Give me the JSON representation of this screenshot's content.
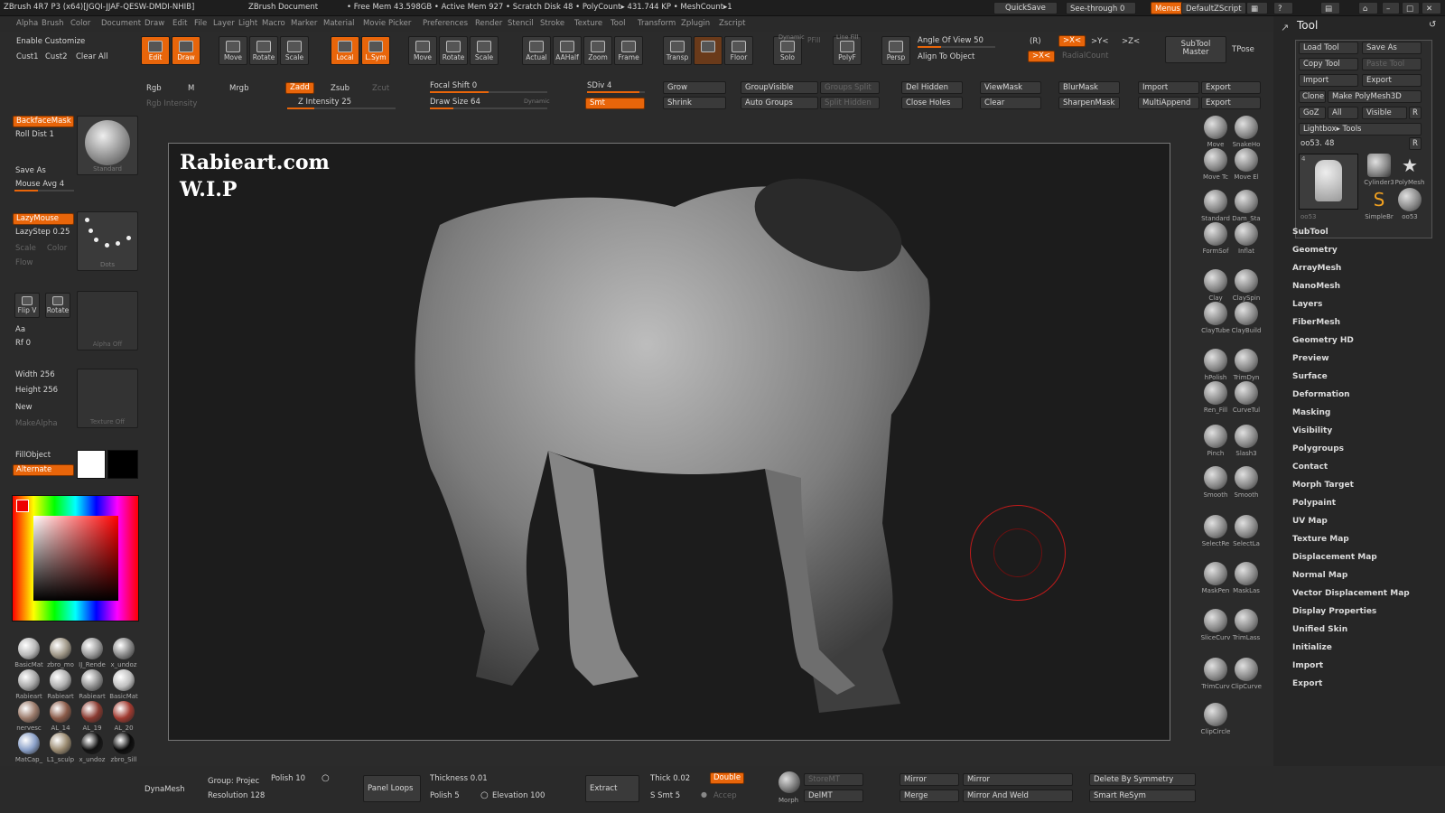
{
  "topbar": {
    "title": "ZBrush 4R7 P3 (x64)[JGQI-JJAF-QESW-DMDI-NHIB]",
    "doc": "ZBrush Document",
    "mem": "• Free Mem 43.598GB • Active Mem 927 • Scratch Disk 48 • PolyCount▸ 431.744 KP • MeshCount▸1",
    "quicksave": "QuickSave",
    "seethrough": "See-through  0",
    "menus": "Menus",
    "script": "DefaultZScript"
  },
  "menu": [
    "Alpha",
    "Brush",
    "Color",
    "Document",
    "Draw",
    "Edit",
    "File",
    "Layer",
    "Light",
    "Macro",
    "Marker",
    "Material",
    "Movie",
    "Picker",
    "Preferences",
    "Render",
    "Stencil",
    "Stroke",
    "Texture",
    "Tool",
    "Transform",
    "Zplugin",
    "Zscript"
  ],
  "toolbar": {
    "enable_customize": "Enable Customize",
    "cust1": "Cust1",
    "cust2": "Cust2",
    "clear_all": "Clear All",
    "tools": [
      "Edit",
      "Draw",
      "Move",
      "Rotate",
      "Scale",
      "Local",
      "L.Sym",
      "Move",
      "Rotate",
      "Scale",
      "Actual",
      "AAHalf",
      "Zoom",
      "Frame",
      "Transp",
      "Ghost",
      "Floor",
      "Solo",
      "PolyF",
      "Persp"
    ],
    "rgb": "Rgb",
    "m": "M",
    "mrgb": "Mrgb",
    "rgb_intensity": "Rgb Intensity",
    "zadd": "Zadd",
    "zsub": "Zsub",
    "zcut": "Zcut",
    "z_intensity": "Z Intensity 25",
    "focal_shift": "Focal Shift 0",
    "draw_size": "Draw Size 64",
    "dynamic": "Dynamic",
    "sdiv": "SDiv 4",
    "smt": "Smt",
    "grow": "Grow",
    "shrink": "Shrink",
    "groupvisible": "GroupVisible",
    "auto_groups": "Auto Groups",
    "groups_split": "Groups Split",
    "split_hidden": "Split Hidden",
    "del_hidden": "Del Hidden",
    "close_holes": "Close Holes",
    "viewmask": "ViewMask",
    "clear": "Clear",
    "blurmask": "BlurMask",
    "sharpenmask": "SharpenMask",
    "import": "Import",
    "multiappend": "MultiAppend",
    "export1": "Export",
    "export2": "Export",
    "angle_of_view": "Angle Of View 50",
    "align_to_object": "Align To Object",
    "r": "(R)",
    "x_sym": ">X<",
    "y_sym": ">Y<",
    "z_sym": ">Z<",
    "radialcount": "RadialCount",
    "subtool_master": "SubTool Master",
    "tpose": "TPose",
    "dynamic_solo": "Dynamic",
    "pfill": "PFill",
    "line_fill": "Line Fill"
  },
  "leftshelf": {
    "backfacemask": "BackfaceMask",
    "roll_dist": "Roll Dist 1",
    "standard": "Standard",
    "save_as": "Save As",
    "mouse_avg": "Mouse Avg 4",
    "lazymouse": "LazyMouse",
    "lazystep": "LazyStep 0.25",
    "scale": "Scale",
    "color": "Color",
    "flow": "Flow",
    "dots": "Dots",
    "flipv": "Flip V",
    "rotate": "Rotate",
    "aa": "Aa",
    "rf": "Rf 0",
    "alpha_off": "Alpha  Off",
    "width": "Width 256",
    "height": "Height 256",
    "new": "New",
    "makealpha": "MakeAlpha",
    "texture_off": "Texture  Off",
    "fillobject": "FillObject",
    "alternate": "Alternate"
  },
  "materials": [
    {
      "label": "BasicMat",
      "color": "#b8b8b8"
    },
    {
      "label": "zbro_mo",
      "color": "#a09888"
    },
    {
      "label": "IJ_Rende",
      "color": "#9a9a9a"
    },
    {
      "label": "x_undoz",
      "color": "#8a8a8a"
    },
    {
      "label": "Rabieart",
      "color": "#a8a8a8"
    },
    {
      "label": "Rabieart",
      "color": "#b0b0b0"
    },
    {
      "label": "Rabieart",
      "color": "#909090"
    },
    {
      "label": "BasicMat",
      "color": "#c0c0c0"
    },
    {
      "label": "nervesc",
      "color": "#9a7a6a"
    },
    {
      "label": "AL_14",
      "color": "#8a5a48"
    },
    {
      "label": "AL_19",
      "color": "#8a3a30"
    },
    {
      "label": "AL_20",
      "color": "#a03a30"
    },
    {
      "label": "MatCap_",
      "color": "#8aa0c8"
    },
    {
      "label": "L1_sculp",
      "color": "#9a8a70"
    },
    {
      "label": "x_undoz",
      "color": "#111111"
    },
    {
      "label": "zbro_Sill",
      "color": "#0a0a0a"
    }
  ],
  "viewport": {
    "line1": "Rabieart.com",
    "line2": "W.I.P"
  },
  "brushes": [
    "Move",
    "SnakeHo",
    "Move Tc",
    "Move El",
    "Standard",
    "Dam_Sta",
    "FormSof",
    "Inflat",
    "Clay",
    "ClaySpin",
    "ClayTube",
    "ClayBuild",
    "hPolish",
    "TrimDyn",
    "Ren_Fill",
    "CurveTul",
    "Pinch",
    "Slash3",
    "Smooth",
    "Smooth",
    "SelectRe",
    "SelectLa",
    "MaskPen",
    "MaskLas",
    "SliceCurv",
    "TrimLass",
    "TrimCurv",
    "ClipCurve",
    "ClipCircle"
  ],
  "rightpanel": {
    "title": "Tool",
    "load_tool": "Load Tool",
    "save_as": "Save As",
    "copy_tool": "Copy Tool",
    "paste_tool": "Paste Tool",
    "import": "Import",
    "export": "Export",
    "clone": "Clone",
    "make_polymesh": "Make PolyMesh3D",
    "goz": "GoZ",
    "all": "All",
    "visible": "Visible",
    "r": "R",
    "lightbox_tools": "Lightbox▸ Tools",
    "current": "oo53. 48",
    "thumb_count": "4",
    "thumbs": [
      "Cylinder3",
      "PolyMesh",
      "SimpleBr",
      "oo53"
    ],
    "current_label": "oo53",
    "sections": [
      "SubTool",
      "Geometry",
      "ArrayMesh",
      "NanoMesh",
      "Layers",
      "FiberMesh",
      "Geometry HD",
      "Preview",
      "Surface",
      "Deformation",
      "Masking",
      "Visibility",
      "Polygroups",
      "Contact",
      "Morph Target",
      "Polypaint",
      "UV Map",
      "Texture Map",
      "Displacement Map",
      "Normal Map",
      "Vector Displacement Map",
      "Display Properties",
      "Unified Skin",
      "Initialize",
      "Import",
      "Export"
    ]
  },
  "bottombar": {
    "dynamesh": "DynaMesh",
    "group_project": "Group: Projec",
    "polish10": "Polish 10",
    "resolution": "Resolution 128",
    "panel_loops": "Panel Loops",
    "thickness": "Thickness 0.01",
    "polish5": "Polish 5",
    "elevation": "Elevation 100",
    "extract": "Extract",
    "thick": "Thick 0.02",
    "double": "Double",
    "s_smt": "S Smt 5",
    "accept": "Accep",
    "morph": "Morph",
    "storemt": "StoreMT",
    "delmt": "DelMT",
    "mirror1": "Mirror",
    "mirror2": "Mirror",
    "merge": "Merge",
    "mirror_and_weld": "Mirror And Weld",
    "delete_by_symmetry": "Delete By Symmetry",
    "smart_resym": "Smart ReSym"
  },
  "colors": {
    "accent": "#e8650a",
    "panel": "#2b2b2b",
    "viewport": "#1c1c1c"
  }
}
